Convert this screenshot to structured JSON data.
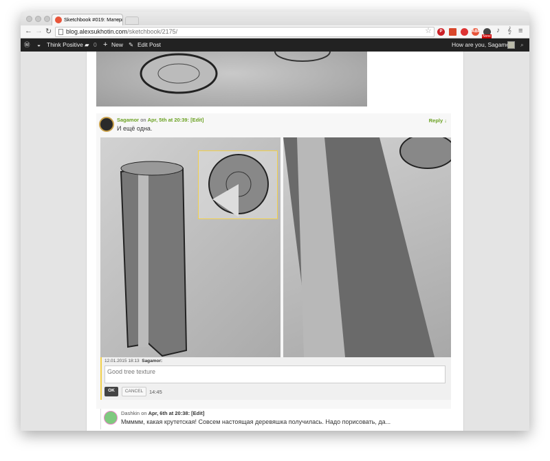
{
  "browser": {
    "tab_title": "Sketchbook #019: Матери...",
    "url_host": "blog.alexsukhotin.com",
    "url_path": "/sketchbook/2175/",
    "ext_badge": "None"
  },
  "wpbar": {
    "site": "Think Positive",
    "comments": "0",
    "new": "New",
    "edit": "Edit Post",
    "greeting": "How are you, Sagamor?"
  },
  "comment1": {
    "author": "Sagamor",
    "on": " on ",
    "date": "Apr, 5th at 20:39",
    "edit": ": [Edit]",
    "reply": "Reply ↓",
    "text": "И ещё одна."
  },
  "annotation": {
    "timestamp": "12.01.2015 18:13",
    "author": "Sagamor:",
    "value": "Good tree texture",
    "ok": "OK",
    "cancel": "CANCEL",
    "time": "14:45"
  },
  "comment2": {
    "author": "Dashkin",
    "on": " on ",
    "date": "Apr, 6th at 20:38",
    "edit": ": [Edit]",
    "text": "Ммммм, какая крутетская! Совсем настоящая деревяшка получилась. Надо порисовать, да..."
  },
  "colors": {
    "accent": "#6aa121",
    "highlight": "#f2d04a"
  }
}
